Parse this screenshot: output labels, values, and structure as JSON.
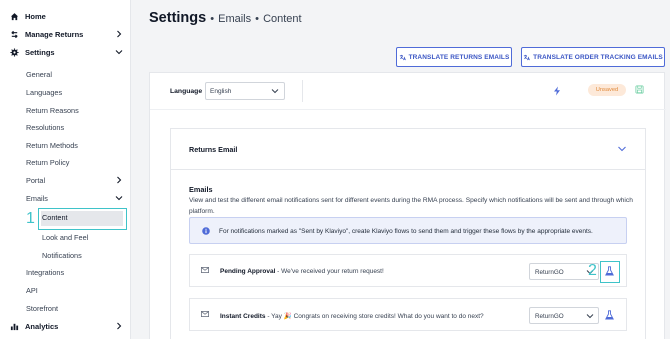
{
  "sidebar": {
    "home": "Home",
    "manage_returns": "Manage Returns",
    "settings": "Settings",
    "settings_items": [
      "General",
      "Languages",
      "Return Reasons",
      "Resolutions",
      "Return Methods",
      "Return Policy"
    ],
    "portal": "Portal",
    "emails": "Emails",
    "emails_items": [
      "Content",
      "Look and Feel",
      "Notifications"
    ],
    "integrations": "Integrations",
    "api": "API",
    "storefront": "Storefront",
    "analytics": "Analytics"
  },
  "annotations": {
    "step1": "1",
    "step2": "2",
    "color": "#3fc3c9"
  },
  "header": {
    "title": "Settings",
    "crumb1": "Emails",
    "crumb2": "Content",
    "separator": "•",
    "translate_returns": "TRANSLATE RETURNS EMAILS",
    "translate_tracking": "TRANSLATE ORDER TRACKING EMAILS"
  },
  "language_bar": {
    "label": "Language",
    "value": "English",
    "status": "Unsaved"
  },
  "returns_email": {
    "title": "Returns Email",
    "emails_title": "Emails",
    "description": "View and test the different email notifications sent for different events during the RMA process. Specify which notifications will be sent and through which platform.",
    "info": "For notifications marked as \"Sent by Klaviyo\", create Klaviyo flows to send them and trigger these flows by the appropriate events.",
    "rows": [
      {
        "name": "Pending Approval",
        "subject": " - We've received your return request!",
        "platform": "ReturnGO"
      },
      {
        "name": "Instant Credits",
        "subject": " - Yay 🎉 Congrats on receiving store credits! What do you want to do next?",
        "platform": "ReturnGO"
      }
    ]
  },
  "colors": {
    "accent": "#4f6bd8",
    "highlight": "#3fc3c9",
    "unsaved_bg": "#fde9d9",
    "unsaved_text": "#e08a3c"
  }
}
